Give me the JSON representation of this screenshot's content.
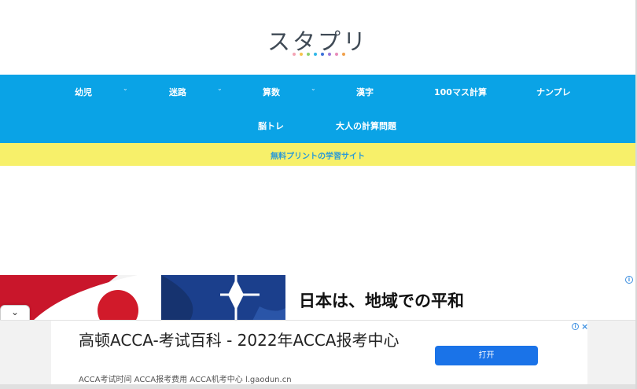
{
  "logo": {
    "text": "スタプリ",
    "dot_colors": [
      "#f4a3b4",
      "#f6c34a",
      "#8fd06c",
      "#2fb6e8",
      "#3a6fd8",
      "#9b79d9",
      "#e88bb8",
      "#f0a04b"
    ]
  },
  "nav": {
    "items": [
      {
        "label": "幼児",
        "has_dropdown": true
      },
      {
        "label": "迷路",
        "has_dropdown": true
      },
      {
        "label": "算数",
        "has_dropdown": true
      },
      {
        "label": "漢字",
        "has_dropdown": false
      },
      {
        "label": "100マス計算",
        "has_dropdown": false
      },
      {
        "label": "ナンプレ",
        "has_dropdown": false
      },
      {
        "label": "脳トレ",
        "has_dropdown": false
      },
      {
        "label": "大人の計算問題",
        "has_dropdown": false
      }
    ],
    "chevron_glyph": "⌄"
  },
  "tagline": "無料プリントの学習サイト",
  "news": {
    "headline": "日本は、地域での平和",
    "info_glyph": "i"
  },
  "collapse_glyph": "⌄",
  "ad": {
    "title": "高顿ACCA-考试百科 - 2022年ACCA报考中心",
    "description": "ACCA考试时间 ACCA报考费用 ACCA机考中心 l.gaodun.cn",
    "button_label": "打开",
    "info_glyph": "i",
    "close_glyph": "×"
  },
  "colors": {
    "nav_bg": "#0aa3e6",
    "tagline_bg": "#f7f06a",
    "tagline_text": "#2b9ad6",
    "ad_button": "#1a73e8"
  }
}
